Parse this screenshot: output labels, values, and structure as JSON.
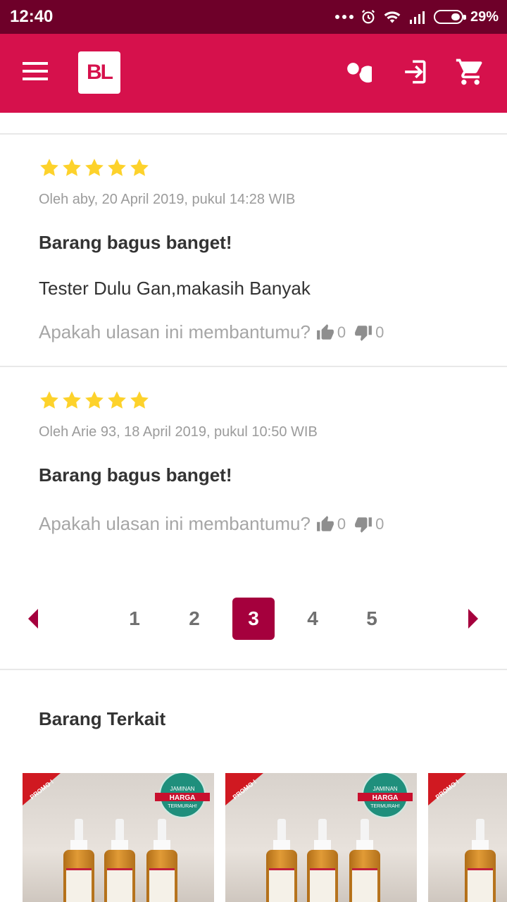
{
  "status_bar": {
    "time": "12:40",
    "battery": "29%"
  },
  "app_bar": {
    "logo": "BL",
    "icons": [
      "menu-icon",
      "search-icon",
      "login-icon",
      "cart-icon"
    ]
  },
  "colors": {
    "status_bar": "#6e0029",
    "app_bar": "#d6114c",
    "accent": "#a5003d",
    "star": "#fdd22b"
  },
  "reviews": [
    {
      "rating": 5,
      "meta": "Oleh aby, 20 April 2019, pukul 14:28 WIB",
      "title": "Barang bagus banget!",
      "body": "Tester Dulu Gan,makasih Banyak",
      "helpful_question": "Apakah ulasan ini membantumu?",
      "up_votes": "0",
      "down_votes": "0"
    },
    {
      "rating": 5,
      "meta": "Oleh Arie 93, 18 April 2019, pukul 10:50 WIB",
      "title": "Barang bagus banget!",
      "body": "",
      "helpful_question": "Apakah ulasan ini membantumu?",
      "up_votes": "0",
      "down_votes": "0"
    }
  ],
  "pagination": {
    "pages": [
      "1",
      "2",
      "3",
      "4",
      "5"
    ],
    "current": "3"
  },
  "related": {
    "title": "Barang Terkait",
    "cards": [
      {
        "promo_label": "PROMO !",
        "badge": [
          "JAMINAN",
          "HARGA",
          "TERMURAH!"
        ]
      },
      {
        "promo_label": "PROMO !",
        "badge": [
          "JAMINAN",
          "HARGA",
          "TERMURAH!"
        ]
      },
      {
        "promo_label": "PROMO !"
      }
    ]
  }
}
